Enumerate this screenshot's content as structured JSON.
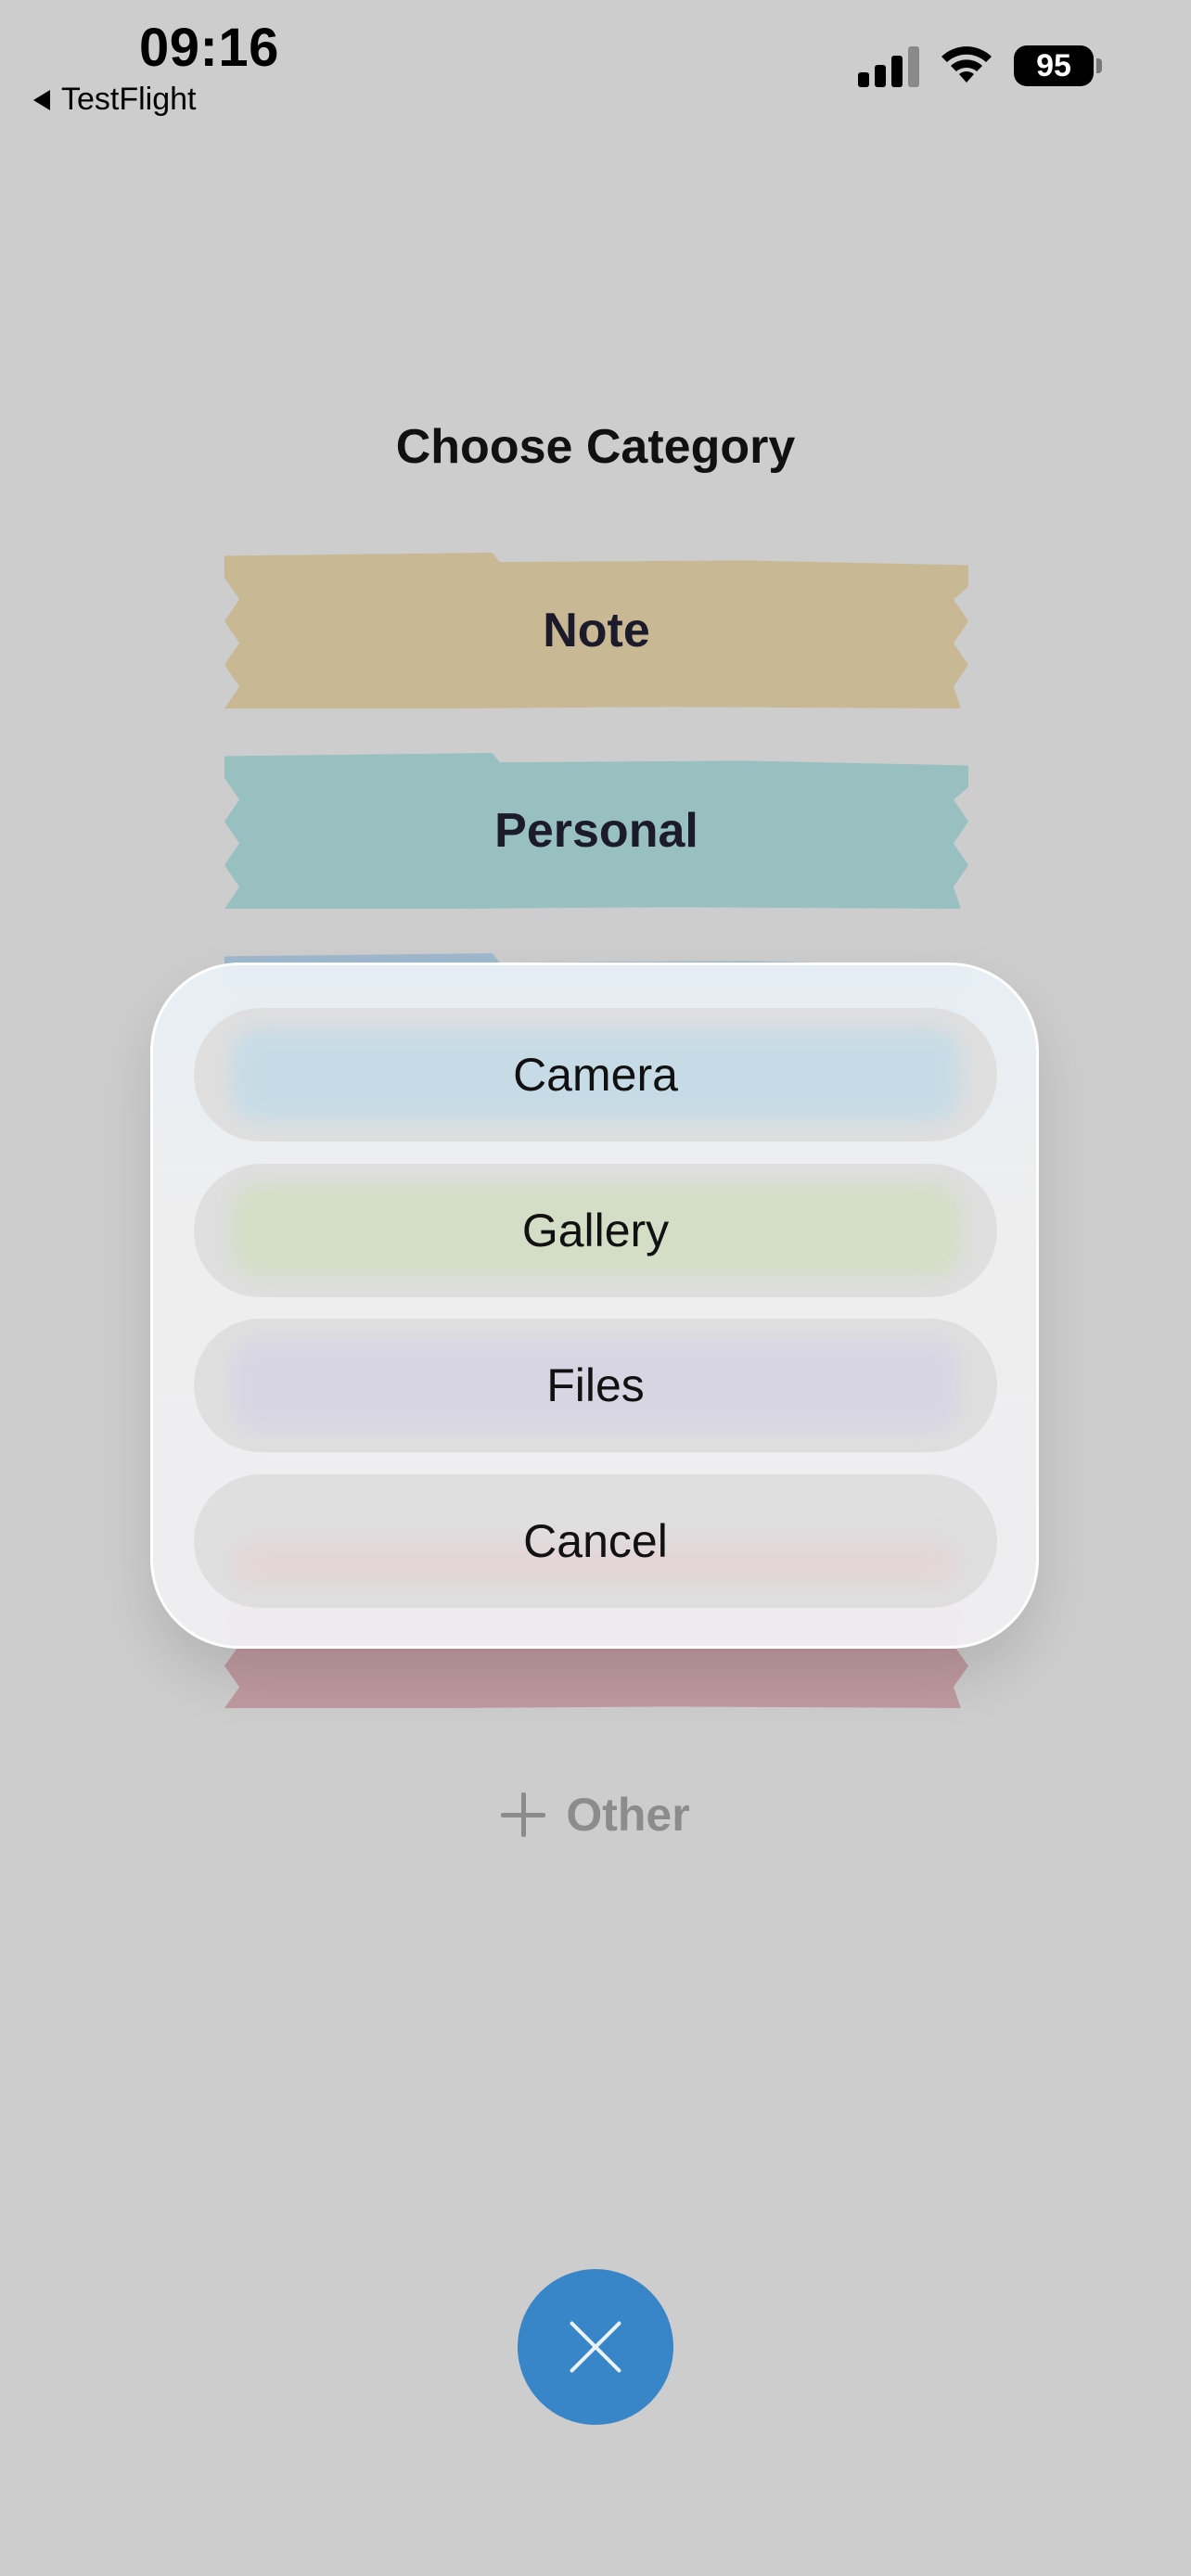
{
  "status_bar": {
    "time": "09:16",
    "back_app": "TestFlight",
    "battery": "95"
  },
  "screen": {
    "title": "Choose Category",
    "categories": [
      {
        "label": "Note",
        "color": "#c8b994"
      },
      {
        "label": "Personal",
        "color": "#99c0c1"
      }
    ],
    "other_label": "Other"
  },
  "action_sheet": {
    "options": [
      "Camera",
      "Gallery",
      "Files"
    ],
    "cancel_label": "Cancel"
  },
  "colors": {
    "background": "#cdcdcd",
    "fab": "#3886c8"
  },
  "icons": {
    "fab": "close-icon",
    "other": "plus-icon",
    "back": "back-triangle-icon"
  }
}
